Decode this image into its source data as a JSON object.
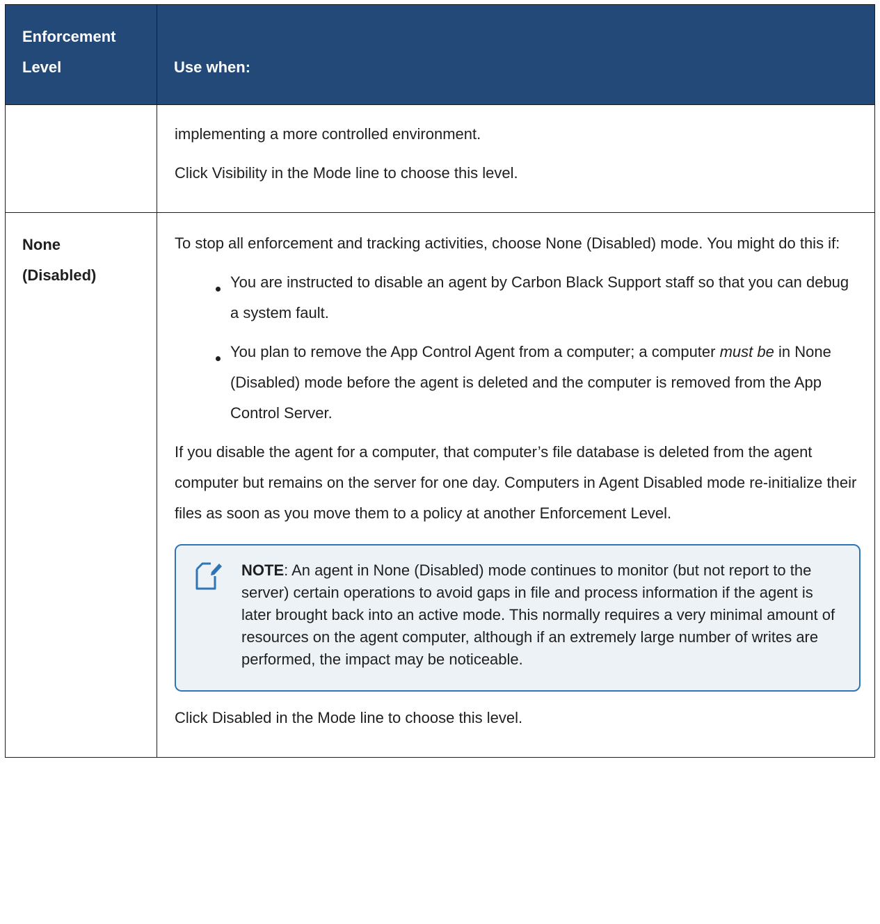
{
  "header": {
    "col1": "Enforcement Level",
    "col1_line1": "Enforcement",
    "col1_line2": "Level",
    "col2": "Use when:"
  },
  "rows": [
    {
      "level": "",
      "paragraphs": [
        "implementing a more controlled environment.",
        "Click Visibility in the Mode line to choose this level."
      ]
    },
    {
      "level_line1": "None",
      "level_line2": "(Disabled)",
      "intro": "To stop all enforcement and tracking activities, choose None (Disabled) mode. You might do this if:",
      "bullets": {
        "b1": "You are instructed to disable an agent by Carbon Black Support staff so that you can debug a system fault.",
        "b2_pre": "You plan to remove the App Control Agent from a computer; a computer ",
        "b2_em": "must be",
        "b2_post": " in None (Disabled) mode before the agent is deleted and the computer is removed from the App Control Server."
      },
      "para_disable": "If you disable the agent for a computer, that computer’s file database is deleted from the agent computer but remains on the server for one day. Computers in Agent Disabled mode re-initialize their files as soon as you move them to a policy at another Enforcement Level.",
      "note": {
        "label": "NOTE",
        "text": ": An agent in None (Disabled) mode continues to monitor (but not report to the server) certain operations to avoid gaps in file and process information if the agent is later brought back into an active mode. This normally requires a very minimal amount of resources on the agent computer, although if an extremely large number of writes are performed, the impact may be noticeable.",
        "icon": "note-icon"
      },
      "final": "Click Disabled in the Mode line to choose this level."
    }
  ]
}
